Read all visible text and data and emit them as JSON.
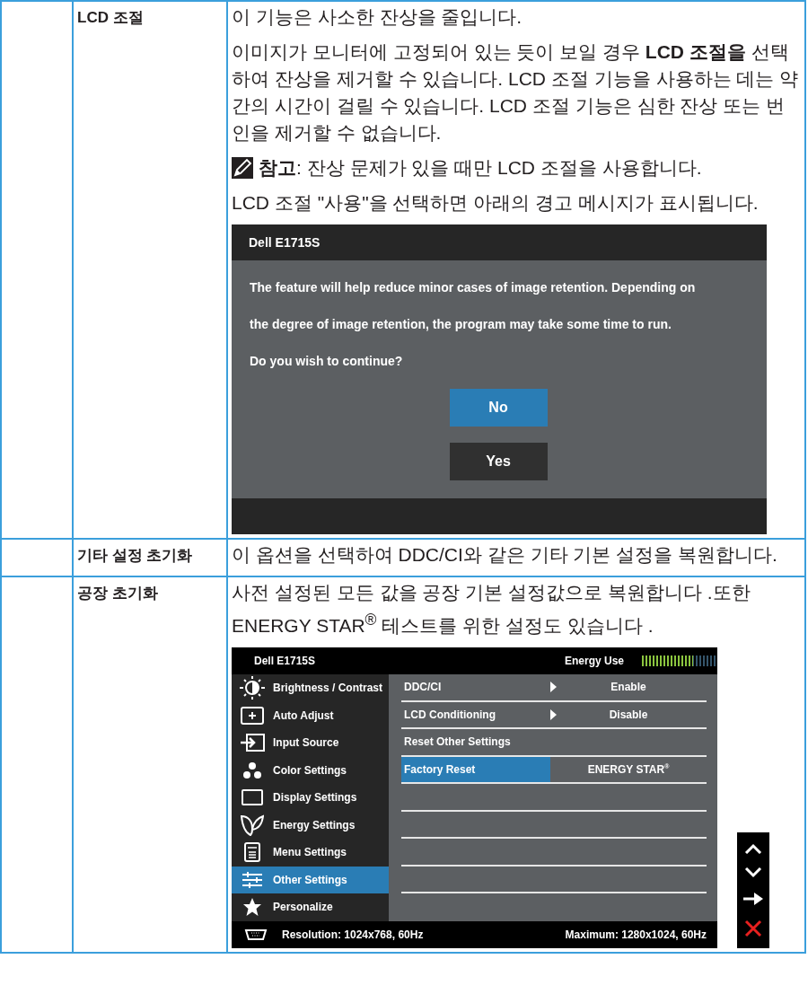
{
  "rows": [
    {
      "setting": "LCD 조절",
      "blocks": [
        {
          "kind": "paragraph",
          "text": "이 기능은 사소한 잔상을 줄입니다."
        },
        {
          "kind": "paragraph",
          "text": "이미지가 모니터에 고정되어 있는 듯이 보일 경우 **LCD 조절을** 선택하여 잔상을 제거할 수 있습니다. LCD 조절 기능을 사용하는 데는 약간의 시간이 걸릴 수 있습니다. LCD 조절 기능은 심한 잔상 또는 번인을 제거할 수 없습니다."
        },
        {
          "kind": "note",
          "text": "**참고**: 잔상 문제가 있을 때만 LCD 조절을 사용합니다."
        },
        {
          "kind": "paragraph",
          "text": "LCD 조절 \"사용\"을 선택하면 아래의 경고 메시지가 표시됩니다."
        },
        {
          "kind": "dialog",
          "title": "Dell E1715S",
          "message_lines": [
            "The feature will help reduce minor cases of image retention. Depending on",
            "the degree of image retention, the program may take some time to run.",
            "Do you wish to continue?"
          ],
          "buttons": [
            {
              "label": "No",
              "selected": true
            },
            {
              "label": "Yes",
              "selected": false
            }
          ]
        }
      ]
    },
    {
      "setting": "기타 설정 초기화",
      "blocks": [
        {
          "kind": "paragraph",
          "text": "이 옵션을 선택하여 DDC/CI와 같은 기타 기본 설정을 복원합니다."
        }
      ]
    },
    {
      "setting": "공장 초기화",
      "blocks": [
        {
          "kind": "paragraph",
          "text": "사전 설정된 모든 값을 공장 기본 설정값으로 복원합니다 .또한 ENERGY STAR$^{®}$ 테스트를 위한 설정도 있습니다 ."
        },
        {
          "kind": "osd",
          "title": "Dell E1715S",
          "energy_label": "Energy Use",
          "energy_meter": {
            "level": 0.7
          },
          "menu_items": [
            {
              "label": "Brightness / Contrast",
              "selected": false
            },
            {
              "label": "Auto Adjust",
              "selected": false
            },
            {
              "label": "Input Source",
              "selected": false
            },
            {
              "label": "Color Settings",
              "selected": false
            },
            {
              "label": "Display Settings",
              "selected": false
            },
            {
              "label": "Energy Settings",
              "selected": false
            },
            {
              "label": "Menu Settings",
              "selected": false
            },
            {
              "label": "Other Settings",
              "selected": true
            },
            {
              "label": "Personalize",
              "selected": false
            }
          ],
          "options": [
            {
              "label": "DDC/CI",
              "submenu": true,
              "value": "Enable",
              "selected": false
            },
            {
              "label": "LCD Conditioning",
              "submenu": true,
              "value": "Disable",
              "selected": false
            },
            {
              "label": "Reset Other Settings",
              "submenu": false,
              "selected": false
            },
            {
              "label": "Factory Reset",
              "submenu": false,
              "value": "ENERGY STAR$^{®}$",
              "selected": true
            }
          ],
          "resolution": "Resolution: 1024x768, 60Hz",
          "maximum": "Maximum: 1280x1024, 60Hz"
        }
      ]
    }
  ]
}
